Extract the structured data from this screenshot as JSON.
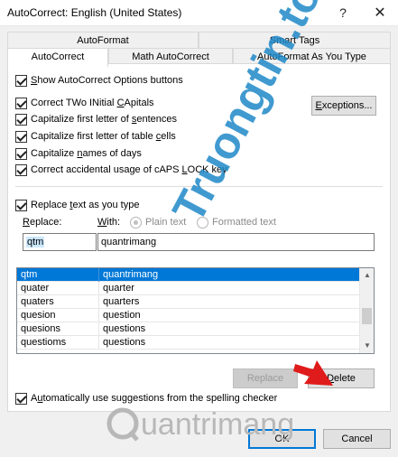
{
  "window": {
    "title": "AutoCorrect: English (United States)",
    "help_glyph": "?",
    "close_glyph": "✕"
  },
  "tabs_back": [
    {
      "label": "AutoFormat"
    },
    {
      "label": "Smart Tags"
    }
  ],
  "tabs_front": [
    {
      "label": "AutoCorrect",
      "active": true
    },
    {
      "label": "Math AutoCorrect",
      "active": false
    },
    {
      "label": "AutoFormat As You Type",
      "active": false
    }
  ],
  "options": {
    "show_buttons": {
      "pre": "",
      "u": "S",
      "post": "how AutoCorrect Options buttons",
      "checked": true
    },
    "two_initial": {
      "pre": "Correct TWo INitial ",
      "u": "C",
      "post": "Apitals",
      "checked": true
    },
    "first_letter": {
      "pre": "Capitalize first letter of ",
      "u": "s",
      "post": "entences",
      "checked": true
    },
    "table_cells": {
      "pre": "Capitalize first letter of table ",
      "u": "c",
      "post": "ells",
      "checked": true
    },
    "days": {
      "pre": "Capitalize ",
      "u": "n",
      "post": "ames of days",
      "checked": true
    },
    "caps_lock": {
      "pre": "Correct accidental usage of cAPS ",
      "u": "L",
      "post": "OCK key",
      "checked": true
    },
    "replace_text": {
      "pre": "Replace ",
      "u": "t",
      "post": "ext as you type",
      "checked": true
    },
    "spelling": {
      "pre": "A",
      "u": "u",
      "post": "tomatically use suggestions from the spelling checker",
      "checked": true
    }
  },
  "exceptions_button": {
    "u": "E",
    "post": "xceptions..."
  },
  "replace_label": {
    "u": "R",
    "post": "eplace:"
  },
  "with_label": {
    "u": "W",
    "post": "ith:"
  },
  "plain_text": "Plain text",
  "formatted_text": "Formatted text",
  "replace_value": "qtm",
  "with_value": "quantrimang",
  "entries": [
    {
      "from": "qtm",
      "to": "quantrimang",
      "selected": true
    },
    {
      "from": "quater",
      "to": "quarter",
      "selected": false
    },
    {
      "from": "quaters",
      "to": "quarters",
      "selected": false
    },
    {
      "from": "quesion",
      "to": "question",
      "selected": false
    },
    {
      "from": "quesions",
      "to": "questions",
      "selected": false
    },
    {
      "from": "questioms",
      "to": "questions",
      "selected": false
    }
  ],
  "replace_button": "Replace",
  "delete_button": {
    "u": "D",
    "post": "elete"
  },
  "ok_button": "OK",
  "cancel_button": "Cancel",
  "watermark_text": "Truongtin.top",
  "logo_text": "uantrimang",
  "colors": {
    "selection": "#0078d7",
    "watermark": "#1e88c8",
    "logo": "#b8b8b8",
    "arrow": "#e01b1b"
  }
}
